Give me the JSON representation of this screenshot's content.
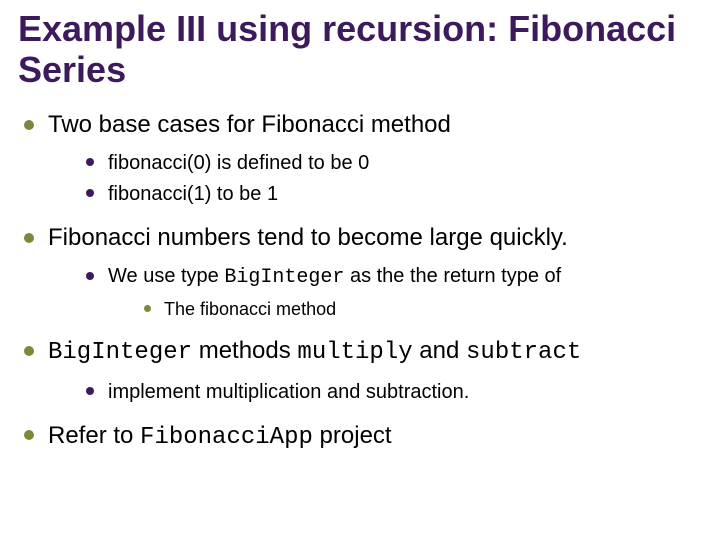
{
  "title": "Example III using recursion: Fibonacci Series",
  "b1": {
    "text": "Two base cases for Fibonacci method",
    "sub1": "fibonacci(0) is defined to be 0",
    "sub2": "fibonacci(1) to be 1"
  },
  "b2": {
    "text": "Fibonacci numbers tend to become large quickly.",
    "sub1_a": "We use type ",
    "sub1_code": "BigInteger",
    "sub1_b": " as the the return type of",
    "sub1_sub1": "The fibonacci method"
  },
  "b3": {
    "code1": "BigInteger",
    "mid1": " methods ",
    "code2": "multiply",
    "mid2": " and ",
    "code3": "subtract",
    "sub1": "implement multiplication and subtraction."
  },
  "b4": {
    "a": "Refer to ",
    "code": "FibonacciApp",
    "b": " project"
  }
}
